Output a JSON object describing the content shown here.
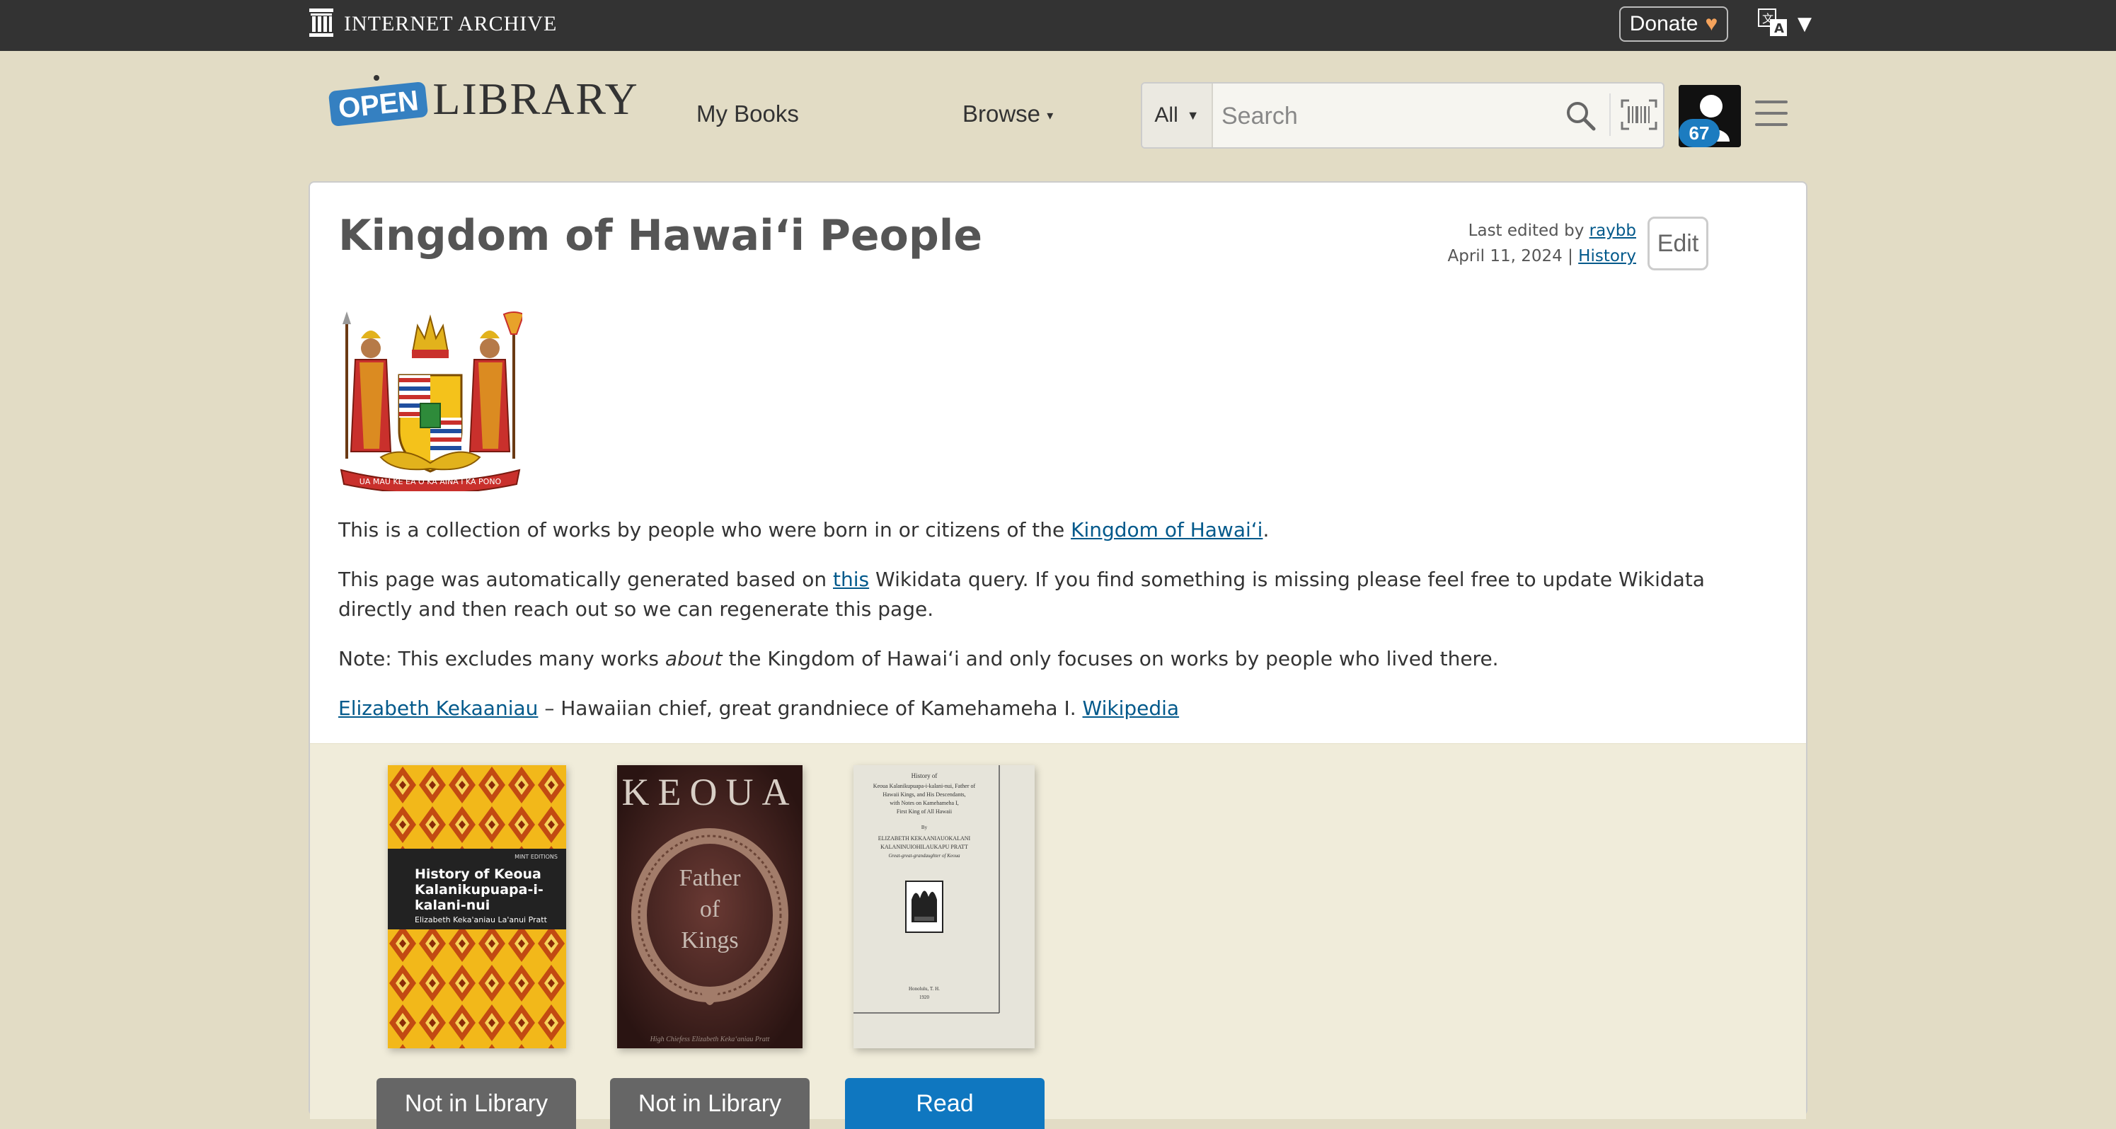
{
  "ia_bar": {
    "logo_text": "INTERNET ARCHIVE",
    "donate_label": "Donate",
    "donate_heart": "♥",
    "lang_caret": "▼",
    "icons": [
      "archive-temple-icon",
      "translate-icon",
      "heart-icon"
    ]
  },
  "header": {
    "logo_open": "OPEN",
    "logo_library": "LIBRARY",
    "nav_mybooks": "My Books",
    "nav_browse": "Browse",
    "search_facet": "All",
    "search_placeholder": "Search",
    "avatar_badge": "67",
    "icons": [
      "search-icon",
      "barcode-icon",
      "avatar-icon",
      "hamburger-icon",
      "caret-down-icon"
    ]
  },
  "page": {
    "title": "Kingdom of Hawaiʻi People",
    "last_edited_prefix": "Last edited by",
    "last_edited_user": "raybb",
    "last_edited_date": "April 11, 2024",
    "separator": "|",
    "history_link": "History",
    "edit_button": "Edit",
    "coat_of_arms_motto": "UA MAU KE EA O KA AINA I KA PONO",
    "intro_text": "This is a collection of works by people who were born in or citizens of the",
    "intro_link": "Kingdom of Hawaiʻi",
    "intro_end": ".",
    "generated_prefix": "This page was automatically generated based on",
    "generated_link": "this",
    "generated_suffix": "Wikidata query. If you find something is missing please feel free to update Wikidata directly and then reach out so we can regenerate this page.",
    "note_prefix": "Note: This excludes many works",
    "note_em": "about",
    "note_suffix": "the Kingdom of Hawaiʻi and only focuses on works by people who lived there.",
    "person_link": "Elizabeth Kekaaniau",
    "person_desc": "– Hawaiian chief, great grandniece of Kamehameha I.",
    "wikipedia_link": "Wikipedia"
  },
  "books": [
    {
      "cover_title": "History of Keoua Kalanikupuapa-i-kalani-nui",
      "cover_author": "Elizabeth Keka'aniau La'anui Pratt",
      "cover_edition": "MINT EDITIONS",
      "button": "Not in Library",
      "button_color": "#666666"
    },
    {
      "cover_header": "KEOUA",
      "cover_line1": "Father",
      "cover_line2": "of",
      "cover_line3": "Kings",
      "cover_footer": "High Chiefess Elizabeth Kekaʻaniau Pratt",
      "button": "Not in Library",
      "button_color": "#666666"
    },
    {
      "cover_line1": "History of",
      "cover_line2": "Keoua Kalanikupuapa-i-kalani-nui, Father of",
      "cover_line3": "Hawaii Kings, and His Descendants,",
      "cover_line4": "with Notes on Kamehameha I,",
      "cover_line5": "First King of All Hawaii",
      "cover_by": "By",
      "cover_author1": "ELIZABETH KEKAANIAUOKALANI",
      "cover_author2": "KALANINUIOHILAUKAPU PRATT",
      "cover_relation": "Great-great-grandaughter of Keoua",
      "cover_place": "Honolulu, T. H.",
      "cover_year": "1920",
      "button": "Read",
      "button_color": "#0f77c0"
    }
  ]
}
